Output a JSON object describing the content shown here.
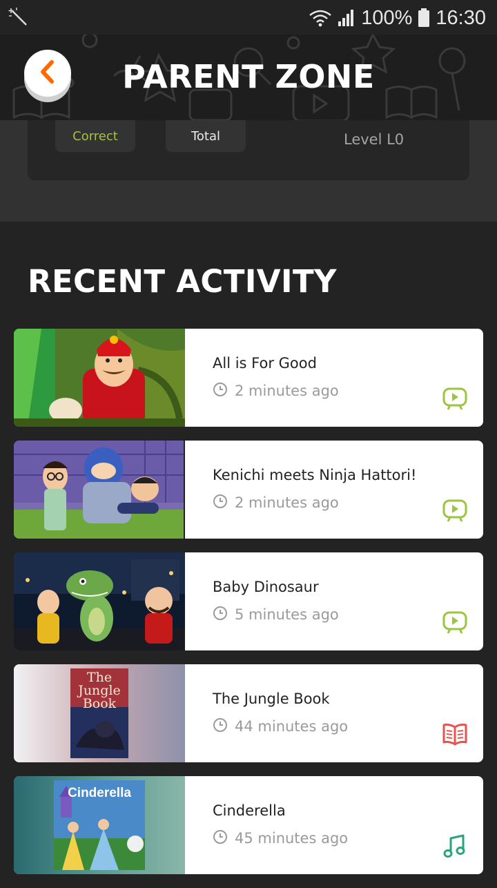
{
  "status_bar": {
    "battery": "100%",
    "time": "16:30"
  },
  "header": {
    "title": "PARENT ZONE"
  },
  "stats": {
    "correct_label": "Correct",
    "total_label": "Total",
    "level": "Level L0"
  },
  "recent": {
    "title": "RECENT ACTIVITY",
    "items": [
      {
        "title": "All is For Good",
        "time": "2 minutes ago",
        "type_icon": "video-icon"
      },
      {
        "title": "Kenichi meets Ninja Hattori!",
        "time": "2 minutes ago",
        "type_icon": "video-icon"
      },
      {
        "title": "Baby Dinosaur",
        "time": "5 minutes ago",
        "type_icon": "video-icon"
      },
      {
        "title": "The Jungle Book",
        "time": "44 minutes ago",
        "type_icon": "book-icon",
        "cover_text": "The Jungle Book"
      },
      {
        "title": "Cinderella",
        "time": "45 minutes ago",
        "type_icon": "music-icon",
        "cover_text": "Cinderella"
      }
    ]
  },
  "colors": {
    "background": "#232323",
    "accent_orange": "#ff6a00",
    "accent_green": "#a6c13b",
    "video_icon": "#9bc53d",
    "book_icon": "#e8534d",
    "music_icon": "#2aa37a"
  }
}
